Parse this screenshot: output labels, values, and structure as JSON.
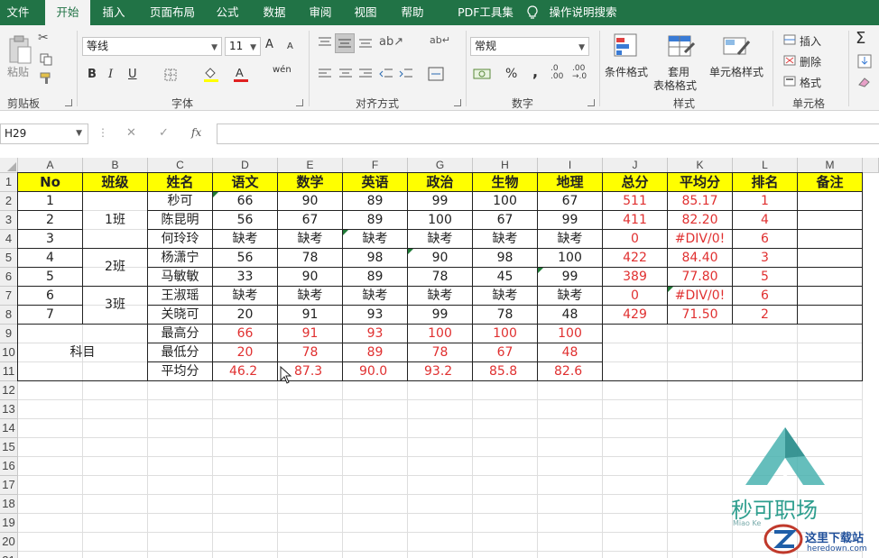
{
  "menu": {
    "tabs": [
      {
        "label": "文件",
        "active": false
      },
      {
        "label": "开始",
        "active": true
      },
      {
        "label": "插入",
        "active": false
      },
      {
        "label": "页面布局",
        "active": false
      },
      {
        "label": "公式",
        "active": false
      },
      {
        "label": "数据",
        "active": false
      },
      {
        "label": "审阅",
        "active": false
      },
      {
        "label": "视图",
        "active": false
      },
      {
        "label": "帮助",
        "active": false
      },
      {
        "label": "PDF工具集",
        "active": false
      }
    ],
    "tell_me": "操作说明搜索"
  },
  "ribbon": {
    "clipboard": {
      "paste": "粘贴",
      "group": "剪贴板"
    },
    "font": {
      "name": "等线",
      "size": "11",
      "bold": "B",
      "italic": "I",
      "underline": "U",
      "grow": "A",
      "shrink": "A",
      "wen": "wén",
      "group": "字体"
    },
    "alignment": {
      "group": "对齐方式"
    },
    "number": {
      "format": "常规",
      "percent": "%",
      "comma": ",",
      "group": "数字"
    },
    "styles": {
      "conditional": "条件格式",
      "table_1": "套用",
      "table_2": "表格格式",
      "cell_styles": "单元格样式",
      "group": "样式"
    },
    "cells": {
      "insert": "插入",
      "delete": "删除",
      "format": "格式",
      "group": "单元格"
    },
    "editing": {
      "sum": "Σ"
    }
  },
  "formula_bar": {
    "name_box": "H29",
    "cancel": "✕",
    "enter": "✓",
    "fx": "fx",
    "value": ""
  },
  "columns": [
    "A",
    "B",
    "C",
    "D",
    "E",
    "F",
    "G",
    "H",
    "I",
    "J",
    "K",
    "L",
    "M"
  ],
  "rows": [
    "1",
    "2",
    "3",
    "4",
    "5",
    "6",
    "7",
    "8",
    "9",
    "10",
    "11",
    "12",
    "13",
    "14",
    "15",
    "16",
    "17",
    "18",
    "19",
    "20",
    "21"
  ],
  "headers": [
    "No",
    "班级",
    "姓名",
    "语文",
    "数学",
    "英语",
    "政治",
    "生物",
    "地理",
    "总分",
    "平均分",
    "排名",
    "备注"
  ],
  "classes": [
    "1班",
    "2班",
    "3班"
  ],
  "students": [
    {
      "no": "1",
      "name": "秒可",
      "scores": [
        "66",
        "90",
        "89",
        "99",
        "100",
        "67"
      ],
      "total": "511",
      "avg": "85.17",
      "rank": "1"
    },
    {
      "no": "2",
      "name": "陈昆明",
      "scores": [
        "56",
        "67",
        "89",
        "100",
        "67",
        "99"
      ],
      "total": "411",
      "avg": "82.20",
      "rank": "4"
    },
    {
      "no": "3",
      "name": "何玲玲",
      "scores": [
        "缺考",
        "缺考",
        "缺考",
        "缺考",
        "缺考",
        "缺考"
      ],
      "total": "0",
      "avg": "#DIV/0!",
      "rank": "6"
    },
    {
      "no": "4",
      "name": "杨潇宁",
      "scores": [
        "56",
        "78",
        "98",
        "90",
        "98",
        "100"
      ],
      "total": "422",
      "avg": "84.40",
      "rank": "3"
    },
    {
      "no": "5",
      "name": "马敏敏",
      "scores": [
        "33",
        "90",
        "89",
        "78",
        "45",
        "99"
      ],
      "total": "389",
      "avg": "77.80",
      "rank": "5"
    },
    {
      "no": "6",
      "name": "王淑瑶",
      "scores": [
        "缺考",
        "缺考",
        "缺考",
        "缺考",
        "缺考",
        "缺考"
      ],
      "total": "0",
      "avg": "#DIV/0!",
      "rank": "6"
    },
    {
      "no": "7",
      "name": "关晓可",
      "scores": [
        "20",
        "91",
        "93",
        "99",
        "78",
        "48"
      ],
      "total": "429",
      "avg": "71.50",
      "rank": "2"
    }
  ],
  "summary": {
    "label": "科目",
    "rows": [
      {
        "name": "最高分",
        "values": [
          "66",
          "91",
          "93",
          "100",
          "100",
          "100"
        ]
      },
      {
        "name": "最低分",
        "values": [
          "20",
          "78",
          "89",
          "78",
          "67",
          "48"
        ]
      },
      {
        "name": "平均分",
        "values": [
          "46.2",
          "87.3",
          "90.0",
          "93.2",
          "85.8",
          "82.6"
        ]
      }
    ]
  },
  "watermark": {
    "brand": "秒可职场",
    "sub": "Miao Ke",
    "site_name": "这里下载站",
    "site_url": "heredown.com"
  },
  "colors": {
    "excel_green": "#217346",
    "header_yellow": "#ffff00",
    "error_red": "#e03030"
  }
}
